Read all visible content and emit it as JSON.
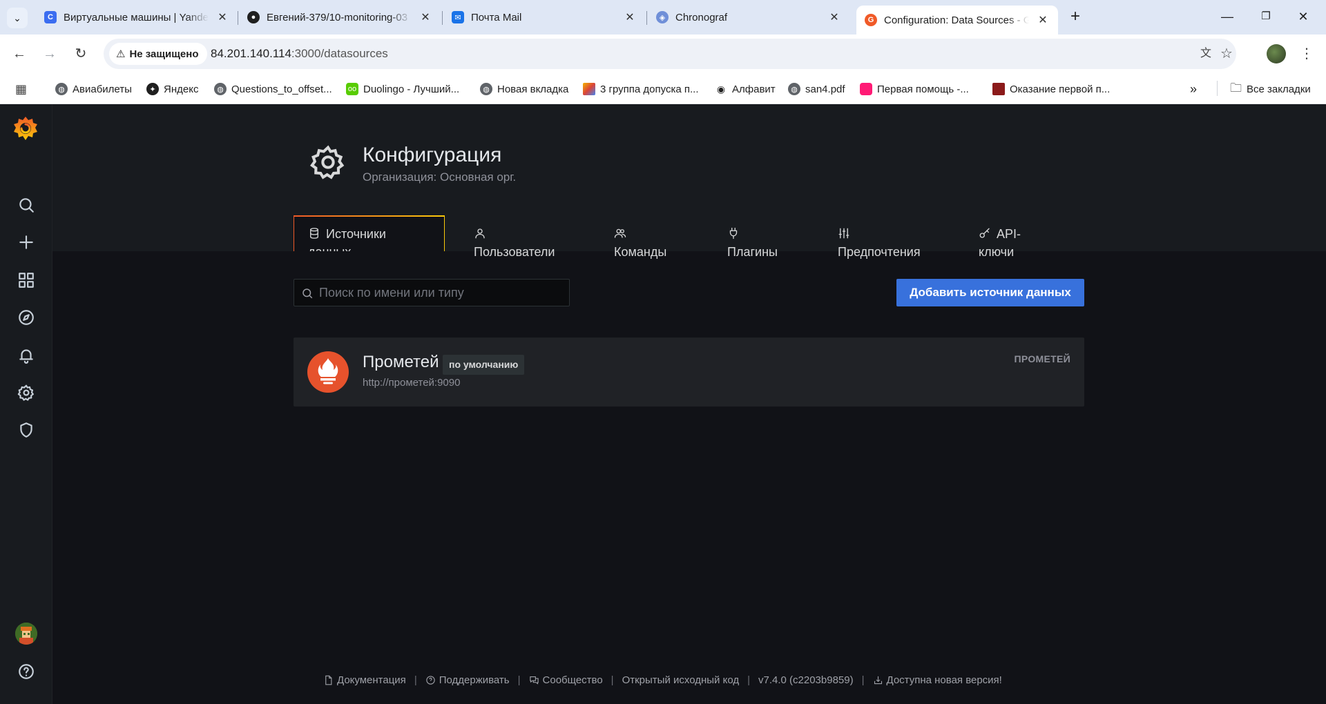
{
  "browser": {
    "tabs": [
      {
        "title": "Виртуальные машины | Yandex",
        "favicon": "yandex-cloud-icon",
        "color": "#3b6df0"
      },
      {
        "title": "Евгений-379/10-monitoring-03",
        "favicon": "github-icon",
        "color": "#1f1f1f"
      },
      {
        "title": "Почта Mail",
        "favicon": "mail-icon",
        "color": "#1a73e8"
      },
      {
        "title": "Chronograf",
        "favicon": "chronograf-icon",
        "color": "#6f8fd8"
      },
      {
        "title": "Configuration: Data Sources - G",
        "favicon": "grafana-icon",
        "color": "#f05a28"
      }
    ],
    "security_label": "Не защищено",
    "url_host": "84.201.140.114",
    "url_path": ":3000/datasources",
    "bookmarks": [
      {
        "label": "Авиабилеты",
        "icon": "globe-icon"
      },
      {
        "label": "Яндекс",
        "icon": "yandex-icon"
      },
      {
        "label": "Questions_to_offset...",
        "icon": "globe-icon"
      },
      {
        "label": "Duolingo - Лучший...",
        "icon": "duolingo-icon"
      },
      {
        "label": "Новая вкладка",
        "icon": "globe-icon"
      },
      {
        "label": "3 группа допуска п...",
        "icon": "bookmark-icon"
      },
      {
        "label": "Алфавит",
        "icon": "eye-icon"
      },
      {
        "label": "san4.pdf",
        "icon": "globe-icon"
      },
      {
        "label": "Первая помощь -...",
        "icon": "bookmark-icon"
      },
      {
        "label": "Оказание первой п...",
        "icon": "bookmark-icon"
      }
    ],
    "all_bookmarks_label": "Все закладки"
  },
  "page": {
    "title": "Конфигурация",
    "subtitle": "Организация: Основная орг.",
    "tabs": [
      {
        "label": "Источники данных",
        "icon": "database-icon",
        "active": true
      },
      {
        "label": "Пользователи",
        "icon": "user-icon"
      },
      {
        "label": "Команды",
        "icon": "users-icon"
      },
      {
        "label": "Плагины",
        "icon": "plug-icon"
      },
      {
        "label": "Предпочтения",
        "icon": "sliders-icon"
      },
      {
        "label": "API-ключи",
        "icon": "key-icon"
      }
    ],
    "search_placeholder": "Поиск по имени или типу",
    "add_button_label": "Добавить источник данных",
    "datasources": [
      {
        "name": "Прометей",
        "badge": "по умолчанию",
        "url": "http://прометей:9090",
        "type": "ПРОМЕТЕЙ"
      }
    ]
  },
  "footer": {
    "documentation": "Документация",
    "support": "Поддерживать",
    "community": "Сообщество",
    "open_source": "Открытый исходный код",
    "version": "v7.4.0 (c2203b9859)",
    "new_version": "Доступна новая версия!"
  },
  "colors": {
    "accent": "#3871dc",
    "grafana_orange": "#f05a28",
    "prometheus": "#e6522c"
  }
}
